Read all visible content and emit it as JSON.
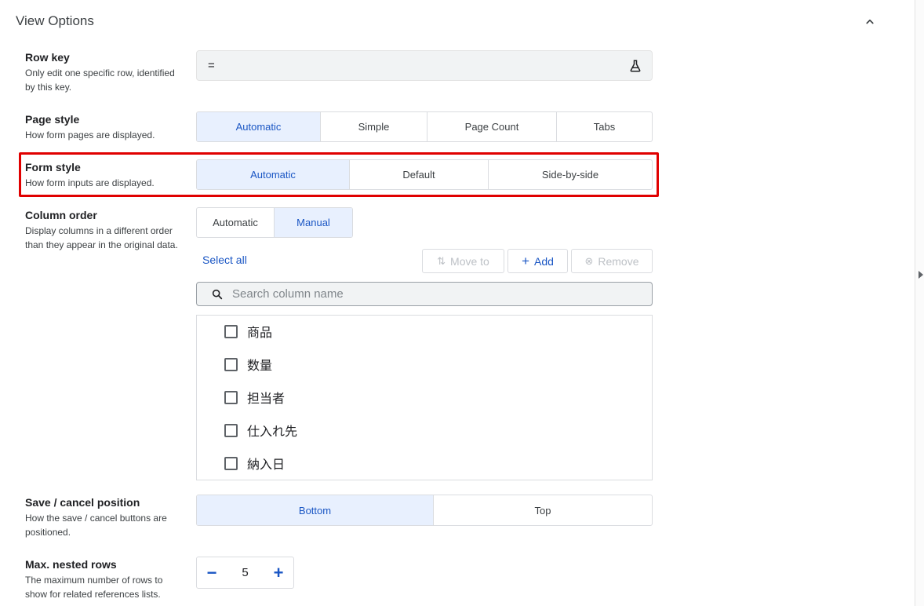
{
  "header": {
    "title": "View Options"
  },
  "row_key": {
    "title": "Row key",
    "desc": "Only edit one specific row, identified by this key.",
    "value": "="
  },
  "page_style": {
    "title": "Page style",
    "desc": "How form pages are displayed.",
    "options": [
      "Automatic",
      "Simple",
      "Page Count",
      "Tabs"
    ],
    "selected": "Automatic"
  },
  "form_style": {
    "title": "Form style",
    "desc": "How form inputs are displayed.",
    "options": [
      "Automatic",
      "Default",
      "Side-by-side"
    ],
    "selected": "Automatic"
  },
  "column_order": {
    "title": "Column order",
    "desc": "Display columns in a different order than they appear in the original data.",
    "options": [
      "Automatic",
      "Manual"
    ],
    "selected": "Manual",
    "select_all": "Select all",
    "move_to": "Move to",
    "add": "Add",
    "remove": "Remove",
    "search_placeholder": "Search column name",
    "columns": [
      "商品",
      "数量",
      "担当者",
      "仕入れ先",
      "納入日"
    ]
  },
  "save_cancel": {
    "title": "Save / cancel position",
    "desc": "How the save / cancel buttons are positioned.",
    "options": [
      "Bottom",
      "Top"
    ],
    "selected": "Bottom"
  },
  "nested_rows": {
    "title": "Max. nested rows",
    "desc": "The maximum number of rows to show for related references lists.",
    "value": "5"
  },
  "colors": {
    "accent": "#1a56c4",
    "active_bg": "#e8f0fe",
    "highlight": "#e00000"
  }
}
